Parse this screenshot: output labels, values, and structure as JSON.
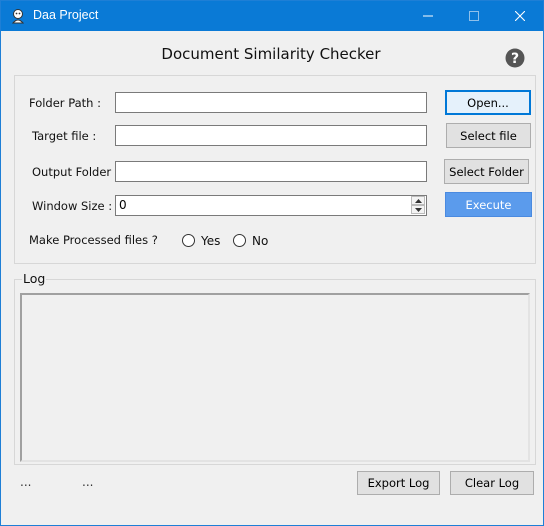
{
  "window": {
    "title": "Daa Project",
    "icons": {
      "app": "app-logo-icon",
      "minimize": "minimize-icon",
      "maximize": "maximize-icon",
      "close": "close-icon"
    }
  },
  "header": {
    "title": "Document Similarity Checker",
    "help_icon": "question-mark-icon"
  },
  "form": {
    "folder_path": {
      "label": "Folder Path :",
      "value": ""
    },
    "target_file": {
      "label": "Target file :",
      "value": ""
    },
    "output_folder": {
      "label": "Output Folder :",
      "value": ""
    },
    "window_size": {
      "label": "Window Size :",
      "value": "0"
    },
    "processed": {
      "label": "Make Processed files ?",
      "options": [
        "Yes",
        "No"
      ],
      "selected": null
    }
  },
  "buttons": {
    "open": "Open...",
    "select_file": "Select file",
    "select_folder": "Select Folder",
    "execute": "Execute",
    "export_log": "Export Log",
    "clear_log": "Clear Log"
  },
  "log": {
    "title": "Log",
    "content": ""
  },
  "status": {
    "left": "...",
    "right": "..."
  },
  "colors": {
    "titlebar": "#0a7ad6",
    "execute_button": "#5b9bec",
    "focus_border": "#0078d7"
  }
}
